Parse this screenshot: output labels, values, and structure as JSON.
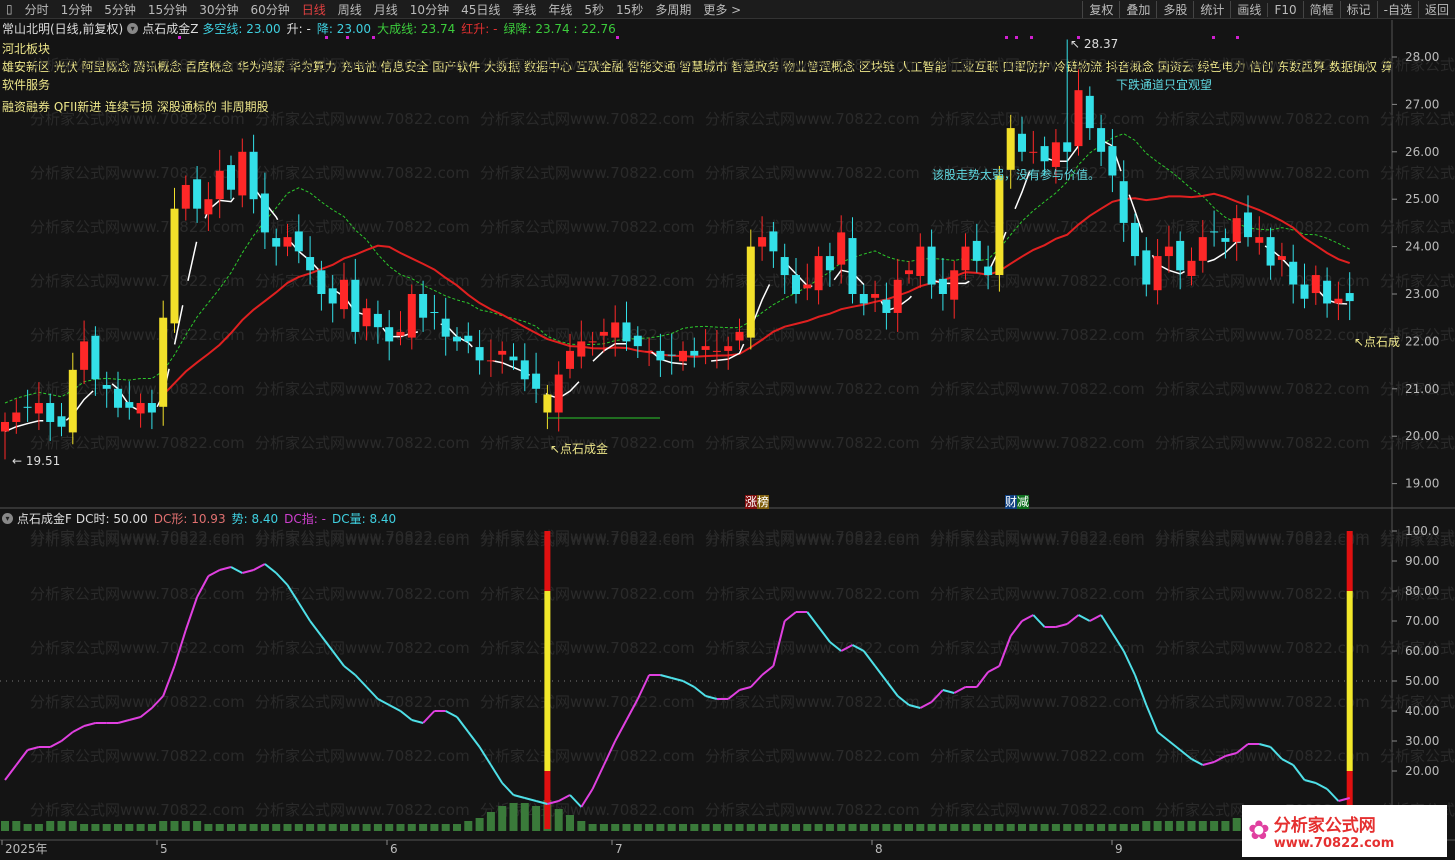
{
  "toolbar": {
    "periods": [
      "分时",
      "1分钟",
      "5分钟",
      "15分钟",
      "30分钟",
      "60分钟",
      "日线",
      "周线",
      "月线",
      "10分钟",
      "45日线",
      "季线",
      "年线",
      "5秒",
      "15秒",
      "多周期",
      "更多 >"
    ],
    "active_period": "日线",
    "right_buttons": [
      "复权",
      "叠加",
      "多股",
      "统计",
      "画线",
      "F10",
      "简框",
      "标记",
      "-自选",
      "返回"
    ]
  },
  "main_header": {
    "stock": "常山北明(日线,前复权)",
    "indicator": "点石成金Z",
    "items": [
      {
        "label": "多空线: 23.00",
        "color": "#3fd0e0"
      },
      {
        "label": "升: -",
        "color": "#dddddd"
      },
      {
        "label": "降: 23.00",
        "color": "#3fd0e0"
      },
      {
        "label": "大成线: 23.74",
        "color": "#3ccc3c"
      },
      {
        "label": "红升: -",
        "color": "#e03030"
      },
      {
        "label": "绿降: 23.74 : 22.76",
        "color": "#3ccc3c"
      }
    ]
  },
  "blocks": {
    "region": "河北板块",
    "concepts": "雄安新区 光伏 阿里概念 腾讯概念 百度概念 华为鸿蒙 华为算力 充电桩 信息安全 国产软件 大数据 数据中心 互联金融 智能交通 智慧城市 智慧政务 物业管理概念 区块链 人工智能 工业互联 口罩防护 冷链物流 抖音概念 国资云 绿色电力 信创 东数西算 数据确权 算力租",
    "industry": "软件服务",
    "tags": "融资融券 QFII新进 连续亏损 深股通标的 非周期股"
  },
  "annotations": {
    "high": "28.37",
    "low": "19.51",
    "weak": "该股走势太弱，没有参与价值。",
    "down_channel": "下跌通道只宜观望",
    "signal": "↖点石成金",
    "signal_right": "↖点石成",
    "limit_up_a": "涨",
    "limit_up_b": "榜",
    "fin_a": "财",
    "fin_b": "减"
  },
  "watermark": "分析家公式网www.70822.com",
  "sub_header": {
    "indicator": "点石成金F",
    "items": [
      {
        "label": "DC时: 50.00",
        "color": "#dddddd"
      },
      {
        "label": "DC形: 10.93",
        "color": "#e07070"
      },
      {
        "label": "势: 8.40",
        "color": "#3fd0e0"
      },
      {
        "label": "DC指: -",
        "color": "#d040d0"
      },
      {
        "label": "DC量: 8.40",
        "color": "#3fd0e0"
      }
    ]
  },
  "logo": {
    "name": "分析家公式网",
    "url": "www.70822.com"
  },
  "chart_data": [
    {
      "type": "candlestick",
      "price_ticks": [
        "28.00",
        "27.00",
        "26.00",
        "25.00",
        "24.00",
        "23.00",
        "22.00",
        "21.00",
        "20.00",
        "19.00"
      ],
      "ylim": [
        18.8,
        28.6
      ],
      "x_ticks": [
        "2025年",
        "5",
        "6",
        "7",
        "8",
        "9"
      ],
      "close": [
        20.3,
        20.5,
        20.6,
        20.7,
        20.3,
        20.2,
        21.4,
        22.0,
        21.2,
        21.0,
        20.6,
        20.6,
        20.7,
        20.5,
        22.5,
        24.8,
        25.3,
        24.8,
        25.0,
        25.6,
        25.2,
        26.0,
        25.0,
        24.3,
        24.0,
        24.2,
        23.9,
        23.5,
        23.0,
        22.8,
        23.3,
        22.2,
        22.7,
        22.3,
        22.0,
        22.2,
        23.0,
        22.5,
        22.6,
        22.1,
        22.0,
        22.0,
        21.6,
        21.6,
        21.8,
        21.6,
        21.2,
        21.0,
        20.5,
        21.3,
        21.8,
        22.0,
        22.0,
        22.2,
        22.4,
        22.0,
        21.9,
        21.8,
        21.6,
        21.7,
        21.8,
        21.7,
        21.9,
        21.8,
        21.9,
        22.2,
        24.0,
        24.2,
        23.9,
        23.4,
        23.0,
        23.2,
        23.8,
        23.5,
        24.3,
        23.0,
        22.8,
        23.0,
        22.6,
        23.3,
        23.5,
        24.0,
        23.2,
        23.0,
        23.5,
        24.0,
        23.7,
        23.4,
        25.5,
        26.5,
        26.0,
        26.0,
        25.8,
        26.2,
        26.0,
        27.3,
        26.5,
        26.0,
        25.5,
        24.5,
        23.8,
        23.2,
        23.8,
        24.0,
        23.5,
        23.7,
        24.2,
        24.3,
        24.1,
        24.6,
        24.2,
        24.2,
        23.6,
        23.8,
        23.2,
        22.9,
        23.4,
        22.8,
        22.9,
        22.85
      ],
      "highlight_yellow": [
        6,
        14,
        15,
        48,
        66,
        88,
        89
      ]
    },
    {
      "type": "line",
      "y_ticks": [
        "100.0",
        "90.00",
        "80.00",
        "70.00",
        "60.00",
        "50.00",
        "40.00",
        "30.00",
        "20.00"
      ],
      "ylim": [
        0,
        100
      ],
      "midline": 50,
      "values": [
        17,
        22,
        27,
        28,
        28,
        30,
        33,
        35,
        36,
        36,
        36,
        37,
        38,
        41,
        45,
        55,
        67,
        78,
        85,
        87,
        88,
        86,
        87,
        89,
        86,
        82,
        76,
        70,
        65,
        60,
        55,
        52,
        48,
        44,
        42,
        40,
        37,
        36,
        40,
        40,
        38,
        33,
        28,
        22,
        16,
        12,
        11,
        10,
        9,
        10,
        12,
        8,
        14,
        22,
        30,
        37,
        44,
        52,
        52,
        51,
        50,
        48,
        45,
        44,
        44,
        47,
        48,
        52,
        55,
        70,
        73,
        73,
        68,
        63,
        60,
        62,
        60,
        55,
        50,
        45,
        42,
        41,
        43,
        47,
        46,
        48,
        48,
        53,
        55,
        65,
        70,
        72,
        68,
        68,
        69,
        72,
        70,
        72,
        66,
        60,
        52,
        42,
        33,
        30,
        27,
        24,
        22,
        23,
        25,
        26,
        29,
        29,
        28,
        24,
        22,
        17,
        16,
        14,
        10,
        11
      ],
      "volume": [
        6,
        6,
        5,
        5,
        6,
        6,
        6,
        5,
        5,
        5,
        5,
        5,
        5,
        5,
        6,
        6,
        6,
        6,
        5,
        5,
        5,
        5,
        5,
        5,
        5,
        5,
        5,
        5,
        5,
        5,
        5,
        5,
        5,
        5,
        5,
        5,
        5,
        5,
        5,
        5,
        5,
        6,
        7,
        9,
        11,
        12,
        12,
        11,
        13,
        10,
        8,
        6,
        5,
        5,
        5,
        5,
        5,
        5,
        5,
        5,
        5,
        5,
        5,
        5,
        5,
        5,
        5,
        5,
        5,
        5,
        5,
        5,
        5,
        5,
        5,
        5,
        5,
        5,
        5,
        5,
        5,
        5,
        5,
        5,
        5,
        5,
        5,
        5,
        5,
        5,
        5,
        5,
        5,
        5,
        5,
        5,
        5,
        5,
        5,
        5,
        5,
        6,
        6,
        6,
        6,
        6,
        6,
        6,
        6,
        7,
        7,
        6,
        6,
        6,
        6,
        6,
        6,
        5,
        6,
        7
      ],
      "signal_bars": [
        48,
        119
      ]
    }
  ]
}
